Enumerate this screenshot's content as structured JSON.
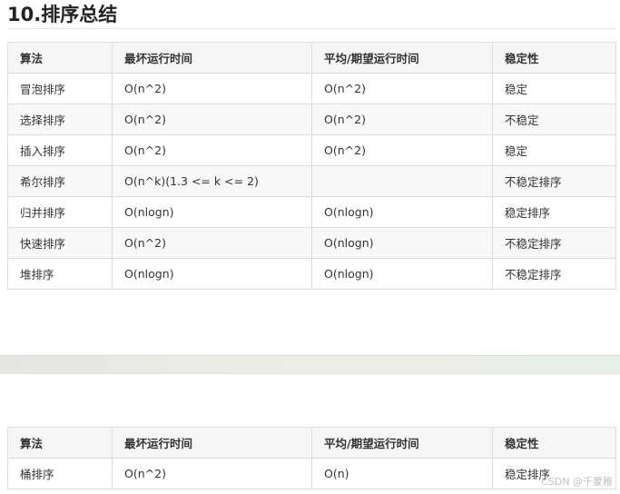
{
  "heading": "10.排序总结",
  "columns": [
    "算法",
    "最坏运行时间",
    "平均/期望运行时间",
    "稳定性"
  ],
  "rows": [
    [
      "冒泡排序",
      "O(n^2)",
      "O(n^2)",
      "稳定"
    ],
    [
      "选择排序",
      "O(n^2)",
      "O(n^2)",
      "不稳定"
    ],
    [
      "插入排序",
      "O(n^2)",
      "O(n^2)",
      "稳定"
    ],
    [
      "希尔排序",
      "O(n^k)(1.3 <= k <= 2)",
      "",
      "不稳定排序"
    ],
    [
      "归并排序",
      "O(nlogn)",
      "O(nlogn)",
      "稳定排序"
    ],
    [
      "快速排序",
      "O(n^2)",
      "O(nlogn)",
      "不稳定排序"
    ],
    [
      "堆排序",
      "O(nlogn)",
      "O(nlogn)",
      "不稳定排序"
    ]
  ],
  "bucket_columns": [
    "算法",
    "最坏运行时间",
    "平均/期望运行时间",
    "稳定性"
  ],
  "bucket_rows": [
    [
      "桶排序",
      "O(n^2)",
      "O(n)",
      "稳定排序"
    ]
  ],
  "watermark": "CSDN @千蒙稚"
}
